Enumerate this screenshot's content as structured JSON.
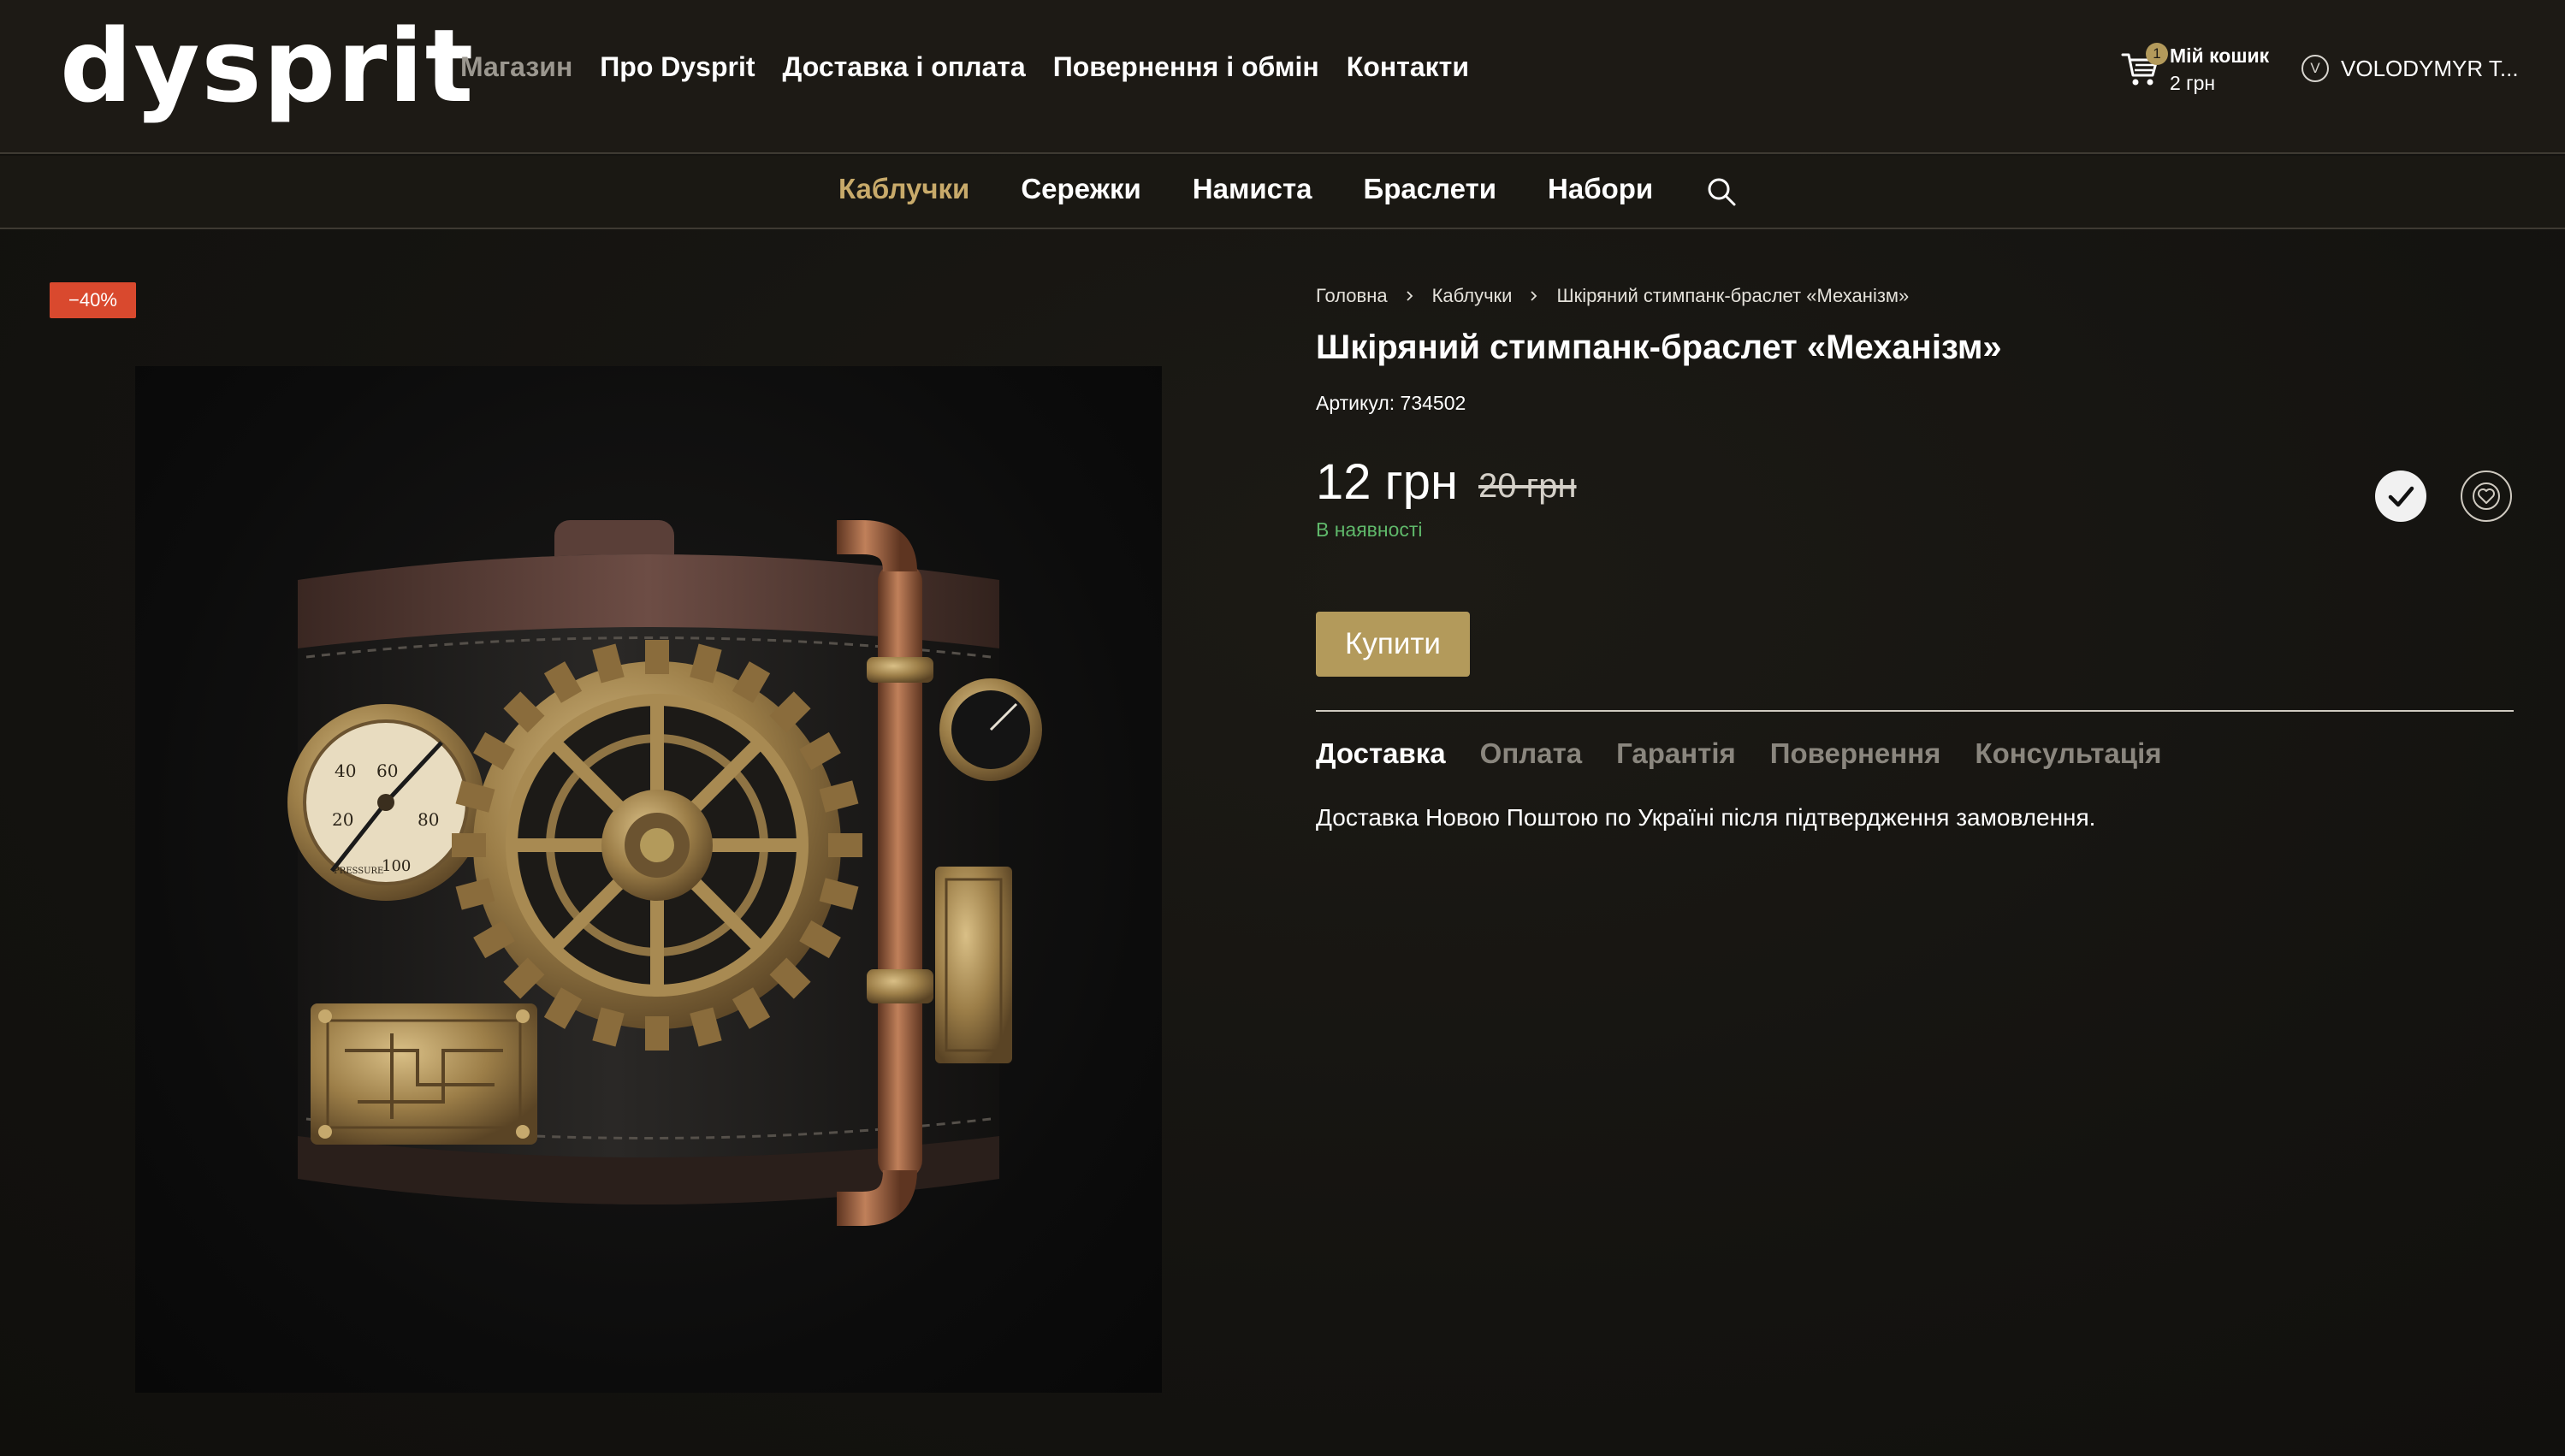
{
  "header": {
    "logo": "dysprit",
    "nav": [
      {
        "label": "Магазин"
      },
      {
        "label": "Про Dysprit"
      },
      {
        "label": "Доставка і оплата"
      },
      {
        "label": "Повернення і обмін"
      },
      {
        "label": "Контакти"
      }
    ],
    "cart": {
      "label": "Мій кошик",
      "total": "2 грн",
      "count": "1",
      "icon": "cart-icon"
    },
    "user": {
      "initial": "V",
      "name": "VOLODYMYR T..."
    }
  },
  "categories": {
    "items": [
      {
        "label": "Каблучки"
      },
      {
        "label": "Сережки"
      },
      {
        "label": "Намиста"
      },
      {
        "label": "Браслети"
      },
      {
        "label": "Набори"
      }
    ],
    "active": "Каблучки",
    "search_icon": "search-icon"
  },
  "product": {
    "discount_badge": "−40%",
    "breadcrumb": [
      "Головна",
      "Каблучки",
      "Шкіряний стимпанк-браслет «Механізм»"
    ],
    "title": "Шкіряний стимпанк-браслет «Механізм»",
    "sku": "Артикул: 734502",
    "price": "12 грн",
    "old_price": "20 грн",
    "stock": "В наявності",
    "buy_label": "Купити",
    "tabs": [
      {
        "label": "Доставка"
      },
      {
        "label": "Оплата"
      },
      {
        "label": "Гарантія"
      },
      {
        "label": "Повернення"
      },
      {
        "label": "Консультація"
      }
    ],
    "active_tab": "Доставка",
    "tab_content": "Доставка Новою Поштою по Україні після підтвердження замовлення.",
    "gauge_labels": [
      "20",
      "40",
      "60",
      "80",
      "100",
      "PRESSURE"
    ]
  },
  "colors": {
    "accent": "#b39a5b",
    "active_category": "#c8aa6a",
    "discount": "#d9492e",
    "in_stock": "#5fb86a",
    "background": "#1d1a15"
  }
}
